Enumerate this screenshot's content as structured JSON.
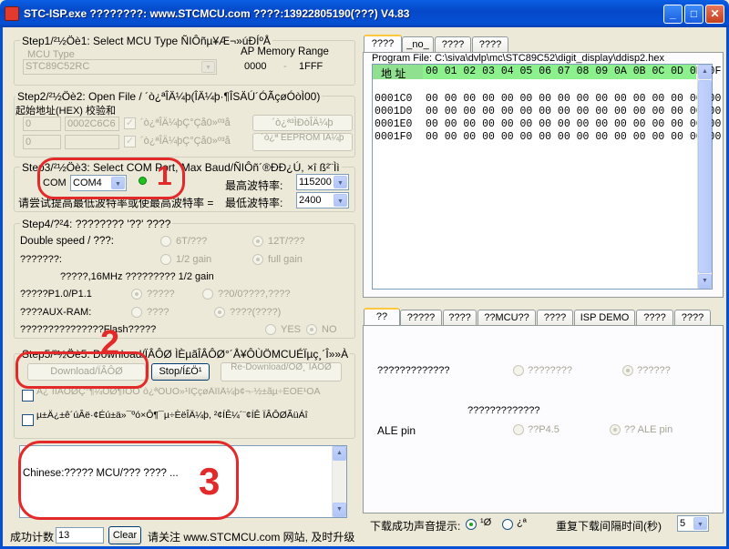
{
  "window": {
    "title": "STC-ISP.exe   ????????: www.STCMCU.com  ????:13922805190(???)  V4.83",
    "buttons": {
      "minimize": "_",
      "maximize": "□",
      "close": "✕"
    }
  },
  "step1": {
    "title": "Step1/²½Öè1: Select MCU Type  ÑIÔñµ¥Æ¬»úÐÍºÅ",
    "mcu_type_label": "MCU Type",
    "mcu_type_value": "STC89C52RC",
    "ap_label": "AP Memory Range",
    "ap_start": "0000",
    "ap_dash": "-",
    "ap_end": "1FFF"
  },
  "step2": {
    "title": "Step2/²½Öè2: Open File / ´ò¿ªÎÄ¼þ(ÎÄ¼þ·¶ÎSÄÚ´ÓÃçøÓòÌ00)",
    "start_label": "起始地址(HEX) 校验和",
    "row1_addr": "0",
    "row1_sum": "0002C6C6",
    "row2_addr": "0",
    "row2_sum": "",
    "chk1_label": "´ò¿ªÎÄ¼þÇ°Çå0»º³å",
    "chk2_label": "´ò¿ªÎÄ¼þÇ°Çå0»º³å",
    "open_prog_btn": "´ò¿ª³ÌÐòÎÄ¼þ",
    "open_eeprom_btn": "´ò¿ª EEPROM ÎÄ¼þ"
  },
  "step3": {
    "title": "Step3/²½Öè3: Select COM Port, Max Baud/ÑIÔñ´®ÐÐ¿Ú, ×î  ß²¨Ìì",
    "com_label": "COM",
    "com_value": "COM4",
    "max_baud_label": "最高波特率:",
    "max_baud_value": "115200",
    "min_note_label": "请尝试提高最低波特率或使最高波特率 =",
    "min_baud_label": "最低波特率:",
    "min_baud_value": "2400"
  },
  "step4": {
    "title": "Step4/?²4: ???????? '??' ????",
    "double_speed_label": "Double speed / ???:",
    "opt_6t": "6T/???",
    "opt_12t": "12T/???",
    "row2_label": "???????:",
    "opt_half_gain": "1/2 gain",
    "opt_full_gain": "full gain",
    "note_16mhz": "?????,16MHz ????????? 1/2 gain",
    "p1_label": "?????P1.0/P1.1",
    "p1_opt1": "?????",
    "p1_opt2": "??0/0????,????",
    "aux_label": "????AUX-RAM:",
    "aux_opt1": "????",
    "aux_opt2": "????(????)",
    "flash_label": "???????????????Flash?????",
    "opt_yes": "YES",
    "opt_no": "NO"
  },
  "step5": {
    "title": "Step5/²½Öè5: Download/ÏÂÔØ  ÌÈµãÎÂÔØ°´Å¥ÔÙÖMCUÉÏµç¸´Î»»À",
    "download_btn": "Download/ÏÂÔØ",
    "stop_btn": "Stop/Í£Ö¹",
    "redownload_btn": "Re-Download/ÖØ¸´ÏÂÔØ",
    "chk1_label": "Ã¿´ÎÏÂÔØÇ°¶¼ÖØ¶ÍÕÒ´ò¿ªÔÙÒ»¹ÎÇçøÄÎÌÄ¼þ¢¬·½±ãµ÷ÊÔÊ¹ÓÃ",
    "chk2_label": "µ±Ä¿±ê´úÂë·¢Éú±ä»¯ºó×Ô¶¯µ÷ÈëÎÄ¼þ, ²¢ÍÊ¼´¨¢ÍÊ ÏÂÔØÃüÁî"
  },
  "log": {
    "text": "Chinese:????? MCU/??? ???? ..."
  },
  "footer": {
    "count_label": "成功计数",
    "count_value": "13",
    "clear_btn": "Clear",
    "notice": "请关注 www.STCMCU.com 网站, 及时升级"
  },
  "top_tabs": [
    {
      "label": "????",
      "active": true
    },
    {
      "label": "_no_",
      "active": false
    },
    {
      "label": "????",
      "active": false
    },
    {
      "label": "????",
      "active": false
    }
  ],
  "hex_view": {
    "program_file_label": "Program File: C:\\siva\\dvlp\\mc\\STC89C52\\digit_display\\ddisp2.hex",
    "addr_header": "地 址",
    "col_header": "00 01 02 03 04 05 06 07 08 09 0A 0B 0C 0D 0E 0F",
    "rows": [
      {
        "addr": "0001C0",
        "bytes": "00 00 00 00 00 00 00 00 00 00 00 00 00 00 00 00"
      },
      {
        "addr": "0001D0",
        "bytes": "00 00 00 00 00 00 00 00 00 00 00 00 00 00 00 00"
      },
      {
        "addr": "0001E0",
        "bytes": "00 00 00 00 00 00 00 00 00 00 00 00 00 00 00 00"
      },
      {
        "addr": "0001F0",
        "bytes": "00 00 00 00 00 00 00 00 00 00 00 00 00 00 00 00"
      }
    ]
  },
  "bottom_tabs": [
    {
      "label": "??",
      "active": true
    },
    {
      "label": "?????",
      "active": false
    },
    {
      "label": "????",
      "active": false
    },
    {
      "label": "??MCU??",
      "active": false
    },
    {
      "label": "????",
      "active": false
    },
    {
      "label": "ISP DEMO",
      "active": false
    },
    {
      "label": "????",
      "active": false
    },
    {
      "label": "????",
      "active": false
    }
  ],
  "options_panel": {
    "row1_label": "?????????????",
    "row1_opt1": "????????",
    "row1_opt2": "??????",
    "row2_title": "?????????????",
    "ale_label": "ALE pin",
    "ale_opt1": "??P4.5",
    "ale_opt2": "?? ALE pin",
    "sound_label": "下载成功声音提示:",
    "sound_opt1": "¹Ø",
    "sound_opt2": "¿ª",
    "repeat_label": "重复下载间隔时间(秒)",
    "repeat_value": "5"
  },
  "annotations": [
    {
      "number": "1",
      "color": "#E32A2A"
    },
    {
      "number": "2",
      "color": "#E32A2A"
    },
    {
      "number": "3",
      "color": "#E32A2A"
    }
  ]
}
